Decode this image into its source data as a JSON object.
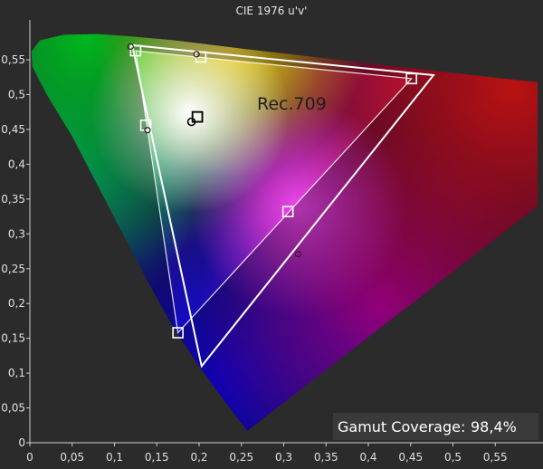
{
  "chart_data": {
    "type": "scatter",
    "title": "CIE 1976 u'v'",
    "xlabel": "",
    "ylabel": "",
    "xlim": [
      0,
      0.6
    ],
    "ylim": [
      0,
      0.6
    ],
    "x_ticks": [
      "0",
      "0,05",
      "0,1",
      "0,15",
      "0,2",
      "0,25",
      "0,3",
      "0,35",
      "0,4",
      "0,45",
      "0,5",
      "0,55"
    ],
    "y_ticks": [
      "0",
      "0,05",
      "0,1",
      "0,15",
      "0,2",
      "0,25",
      "0,3",
      "0,35",
      "0,4",
      "0,45",
      "0,5",
      "0,55"
    ],
    "grid": false,
    "annotation": "Rec.709",
    "gamut_coverage_label": "Gamut Coverage:",
    "gamut_coverage_value": "98,4%",
    "reference_gamut": {
      "name": "Rec.709",
      "points": [
        {
          "u": 0.451,
          "v": 0.523
        },
        {
          "u": 0.125,
          "v": 0.563
        },
        {
          "u": 0.175,
          "v": 0.158
        }
      ],
      "white": {
        "u": 0.198,
        "v": 0.468
      }
    },
    "measured_gamut": {
      "points": [
        {
          "u": 0.477,
          "v": 0.528
        },
        {
          "u": 0.121,
          "v": 0.571
        },
        {
          "u": 0.203,
          "v": 0.11
        }
      ]
    },
    "target_markers": [
      {
        "u": 0.125,
        "v": 0.563
      },
      {
        "u": 0.202,
        "v": 0.554
      },
      {
        "u": 0.451,
        "v": 0.523
      },
      {
        "u": 0.137,
        "v": 0.456
      },
      {
        "u": 0.198,
        "v": 0.468
      },
      {
        "u": 0.305,
        "v": 0.332
      },
      {
        "u": 0.175,
        "v": 0.158
      }
    ],
    "measured_markers": [
      {
        "u": 0.119,
        "v": 0.569
      },
      {
        "u": 0.197,
        "v": 0.558
      },
      {
        "u": 0.139,
        "v": 0.449
      },
      {
        "u": 0.191,
        "v": 0.461
      },
      {
        "u": 0.317,
        "v": 0.271
      }
    ],
    "colors": {
      "background": "#2b2b2b",
      "triangle": "#ffffff",
      "annotation": "#1e1e1e"
    }
  }
}
